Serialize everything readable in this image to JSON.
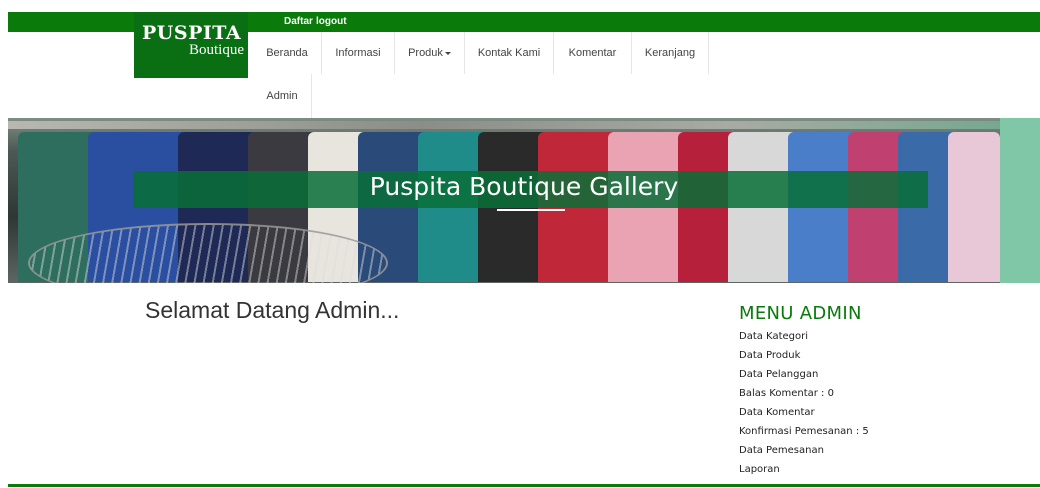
{
  "topbar": {
    "daftar_label": "Daftar",
    "logout_label": "logout"
  },
  "logo": {
    "main": "PUSPITA",
    "sub": "Boutique"
  },
  "nav": [
    {
      "label": "Beranda"
    },
    {
      "label": "Informasi"
    },
    {
      "label": "Produk",
      "has_dropdown": true
    },
    {
      "label": "Kontak Kami"
    },
    {
      "label": "Komentar"
    },
    {
      "label": "Keranjang"
    },
    {
      "label": "Admin"
    }
  ],
  "hero": {
    "title": "Puspita Boutique Gallery"
  },
  "main": {
    "welcome": "Selamat Datang Admin..."
  },
  "admin_menu": {
    "title": "MENU ADMIN",
    "items": [
      "Data Kategori",
      "Data Produk",
      "Data Pelanggan",
      "Balas Komentar : 0",
      "Data Komentar",
      "Konfirmasi Pemesanan : 5",
      "Data Pemesanan",
      "Laporan"
    ]
  },
  "colors": {
    "brand_green": "#0a7a0a",
    "logo_green": "#0a6e12",
    "hero_band": "#086e37"
  }
}
